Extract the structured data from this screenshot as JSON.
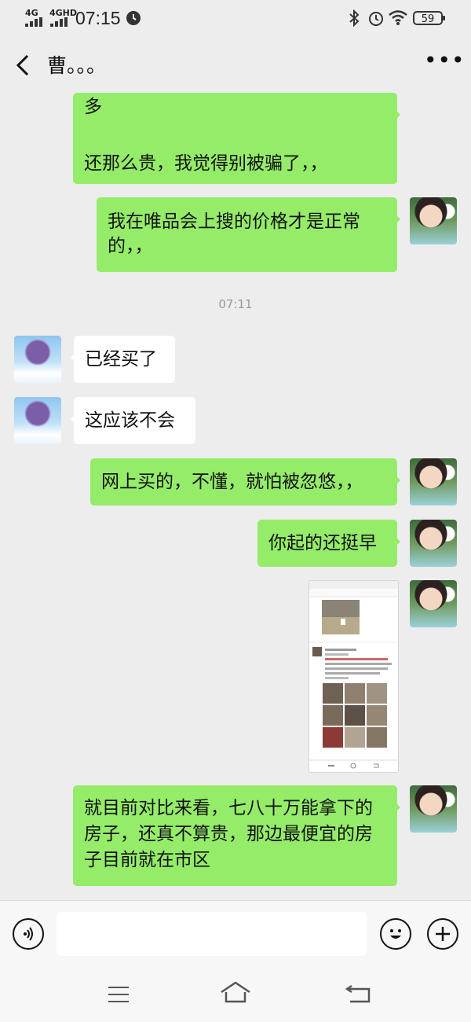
{
  "status": {
    "sig1": "4G",
    "sig2": "4GHD",
    "time": "07:15",
    "battery": "59"
  },
  "header": {
    "title": "曹。。。",
    "more": "•••"
  },
  "messages": {
    "m0": "多\n\n还那么贵，我觉得别被骗了，，",
    "m1": "我在唯品会上搜的价格才是正常的，，",
    "ts": "07:11",
    "m2": "已经买了",
    "m3": "这应该不会",
    "m4": "网上买的，不懂，就怕被忽悠，，",
    "m5": "你起的还挺早",
    "m7": "就目前对比来看，七八十万能拿下的房子，还真不算贵，那边最便宜的房子目前就在市区"
  },
  "icons": {
    "back": "chevron-left-icon",
    "voice": "voice-icon",
    "emoji": "emoji-icon",
    "add": "plus-icon",
    "menu": "menu-icon",
    "home": "home-icon",
    "return": "back-nav-icon"
  },
  "colors": {
    "mine_bubble": "#95ec69",
    "theirs_bubble": "#ffffff",
    "background": "#ededed"
  }
}
